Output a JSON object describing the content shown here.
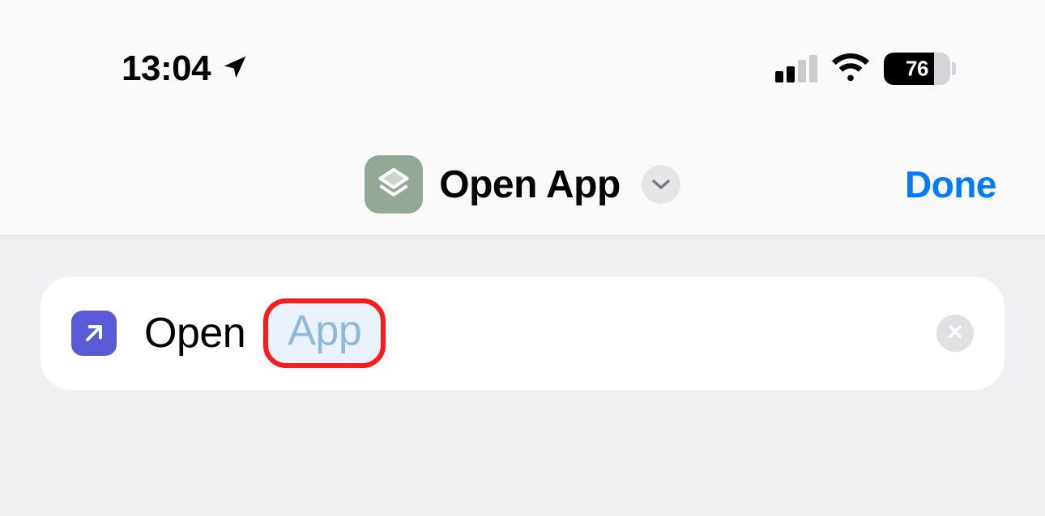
{
  "status": {
    "time": "13:04",
    "battery_percent": "76"
  },
  "nav": {
    "title": "Open App",
    "done_label": "Done"
  },
  "action": {
    "open_label": "Open",
    "app_token": "App"
  }
}
